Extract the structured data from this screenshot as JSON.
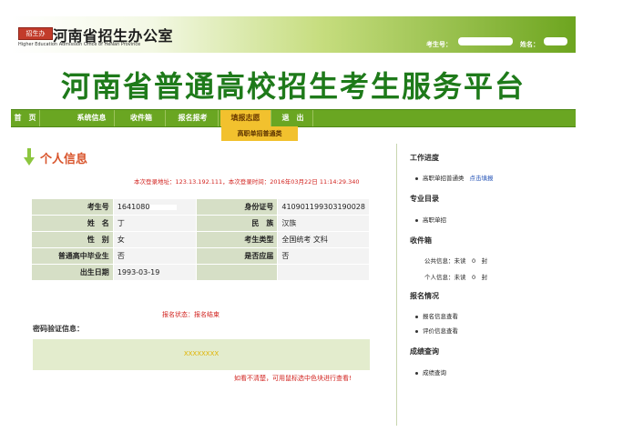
{
  "header": {
    "logo_badge": "招生办",
    "office_title": "河南省招生办公室",
    "office_en": "Higher Education Admission Office of HeNan Province",
    "candidate_no_label": "考生号：",
    "name_label": "姓名："
  },
  "banner": {
    "title": "河南省普通高校招生考生服务平台"
  },
  "nav": {
    "items": [
      "首　页",
      "系统信息",
      "收件箱",
      "报名报考",
      "填报志愿",
      "退　出"
    ],
    "active_index": 4,
    "sub_item": "高职单招普通类"
  },
  "section": {
    "title": "个人信息"
  },
  "login_info": "本次登录地址：123.13.192.111，本次登录时间：2016年03月22日 11:14:29.340",
  "table": {
    "rows": [
      {
        "l1": "考生号",
        "v1": "1641080",
        "l2": "身份证号",
        "v2": "410901199303190028"
      },
      {
        "l1": "姓　名",
        "v1": "丁",
        "l2": "民　族",
        "v2": "汉族"
      },
      {
        "l1": "性　别",
        "v1": "女",
        "l2": "考生类型",
        "v2": "全国统考 文科"
      },
      {
        "l1": "普通高中毕业生",
        "v1": "否",
        "l2": "是否应届",
        "v2": "否"
      },
      {
        "l1": "出生日期",
        "v1": "1993-03-19",
        "l2": "",
        "v2": ""
      }
    ]
  },
  "enroll_status": "报名状态：报名结束",
  "password": {
    "label": "密码验证信息：",
    "code": "XXXXXXXX",
    "hint": "如看不清楚，可用鼠标选中色块进行查看!"
  },
  "sidebar": {
    "sections": [
      {
        "title": "工作进度",
        "items": [
          {
            "text": "高职单招普通类",
            "link": "点击填报"
          }
        ]
      },
      {
        "title": "专业目录",
        "items": [
          {
            "text": "高职单招",
            "link": ""
          }
        ]
      },
      {
        "title": "收件箱",
        "items": [
          {
            "text": "公共信息：未读　0　封",
            "link": ""
          },
          {
            "text": "个人信息：未读　0　封",
            "link": ""
          }
        ]
      },
      {
        "title": "报名情况",
        "items": [
          {
            "text": "报名信息查看",
            "link": ""
          },
          {
            "text": "评价信息查看",
            "link": ""
          }
        ]
      },
      {
        "title": "成绩查询",
        "items": [
          {
            "text": "成绩查询",
            "link": ""
          }
        ]
      }
    ]
  },
  "colors": {
    "brand_green": "#6aa622",
    "title_green": "#1e7a1a",
    "active_tab": "#f2c12e",
    "alert_red": "#d2231f",
    "link_blue": "#1f4fb5"
  }
}
